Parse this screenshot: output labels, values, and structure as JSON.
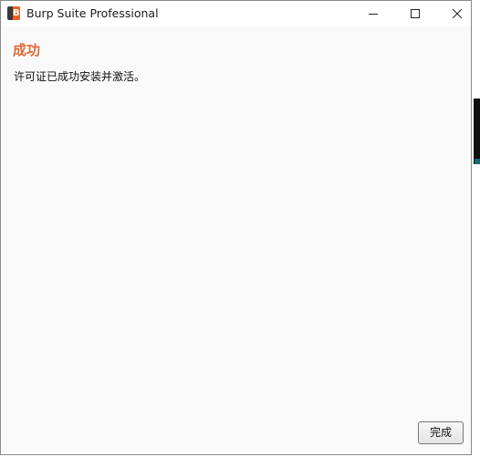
{
  "window": {
    "title": "Burp Suite Professional",
    "app_icon": "burp-suite-icon",
    "app_icon_glyph": "B"
  },
  "controls": {
    "minimize_icon": "minimize-icon",
    "maximize_icon": "maximize-icon",
    "close_icon": "close-icon"
  },
  "content": {
    "heading": "成功",
    "message": "许可证已成功安装并激活。"
  },
  "footer": {
    "finish_label": "完成"
  },
  "colors": {
    "heading": "#e06a35",
    "window_bg": "#f9f9f9",
    "titlebar_bg": "#ffffff",
    "brand_orange": "#e8632a"
  }
}
